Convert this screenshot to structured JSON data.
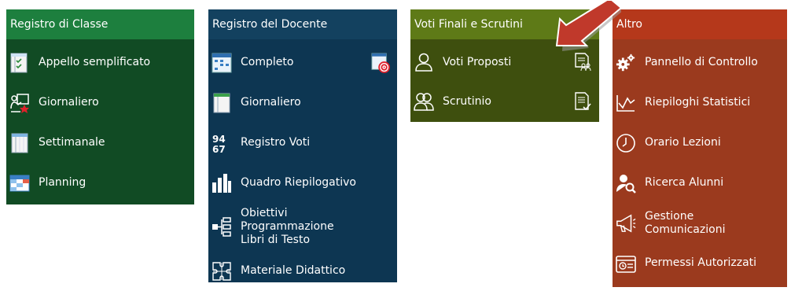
{
  "panels": {
    "classe": {
      "title": "Registro di Classe",
      "items": [
        {
          "label": "Appello semplificato",
          "icon": "attendance-sheet-icon"
        },
        {
          "label": "Giornaliero",
          "icon": "teacher-blackboard-icon"
        },
        {
          "label": "Settimanale",
          "icon": "weekly-sheet-icon"
        },
        {
          "label": "Planning",
          "icon": "planning-grid-icon"
        }
      ]
    },
    "docente": {
      "title": "Registro del Docente",
      "items": [
        {
          "label": "Completo",
          "icon": "full-register-grid-icon",
          "icon_right": "target-grid-icon"
        },
        {
          "label": "Giornaliero",
          "icon": "daily-sheet-icon"
        },
        {
          "label": "Registro Voti",
          "icon": "grades-numbers-icon"
        },
        {
          "label": "Quadro Riepilogativo",
          "icon": "bar-chart-icon"
        },
        {
          "label": "Obiettivi Programmazione Libri di Testo",
          "icon": "hierarchy-icon"
        },
        {
          "label": "Materiale Didattico",
          "icon": "puzzle-icon"
        }
      ]
    },
    "voti": {
      "title": "Voti Finali e Scrutini",
      "items": [
        {
          "label": "Voti Proposti",
          "icon": "single-user-outline-icon",
          "icon_right": "document-users-icon"
        },
        {
          "label": "Scrutinio",
          "icon": "group-users-outline-icon",
          "icon_right": "document-check-icon"
        }
      ]
    },
    "altro": {
      "title": "Altro",
      "items": [
        {
          "label": "Pannello di Controllo",
          "icon": "gears-icon"
        },
        {
          "label": "Riepiloghi Statistici",
          "icon": "line-chart-icon"
        },
        {
          "label": "Orario Lezioni",
          "icon": "clock-icon"
        },
        {
          "label": "Ricerca Alunni",
          "icon": "user-search-icon"
        },
        {
          "label": "Gestione Comunicazioni",
          "icon": "megaphone-icon"
        },
        {
          "label": "Permessi Autorizzati",
          "icon": "permission-clock-icon"
        }
      ]
    }
  },
  "colors": {
    "classe_header": "#1d7f3e",
    "classe_body": "#114b24",
    "docente_header": "#13415f",
    "docente_body": "#0d3652",
    "voti_header": "#5e7a17",
    "voti_body": "#3e4f0e",
    "altro_header": "#b5381b",
    "altro_body": "#9b3a1e",
    "annotation_arrow": "#c0392b"
  }
}
